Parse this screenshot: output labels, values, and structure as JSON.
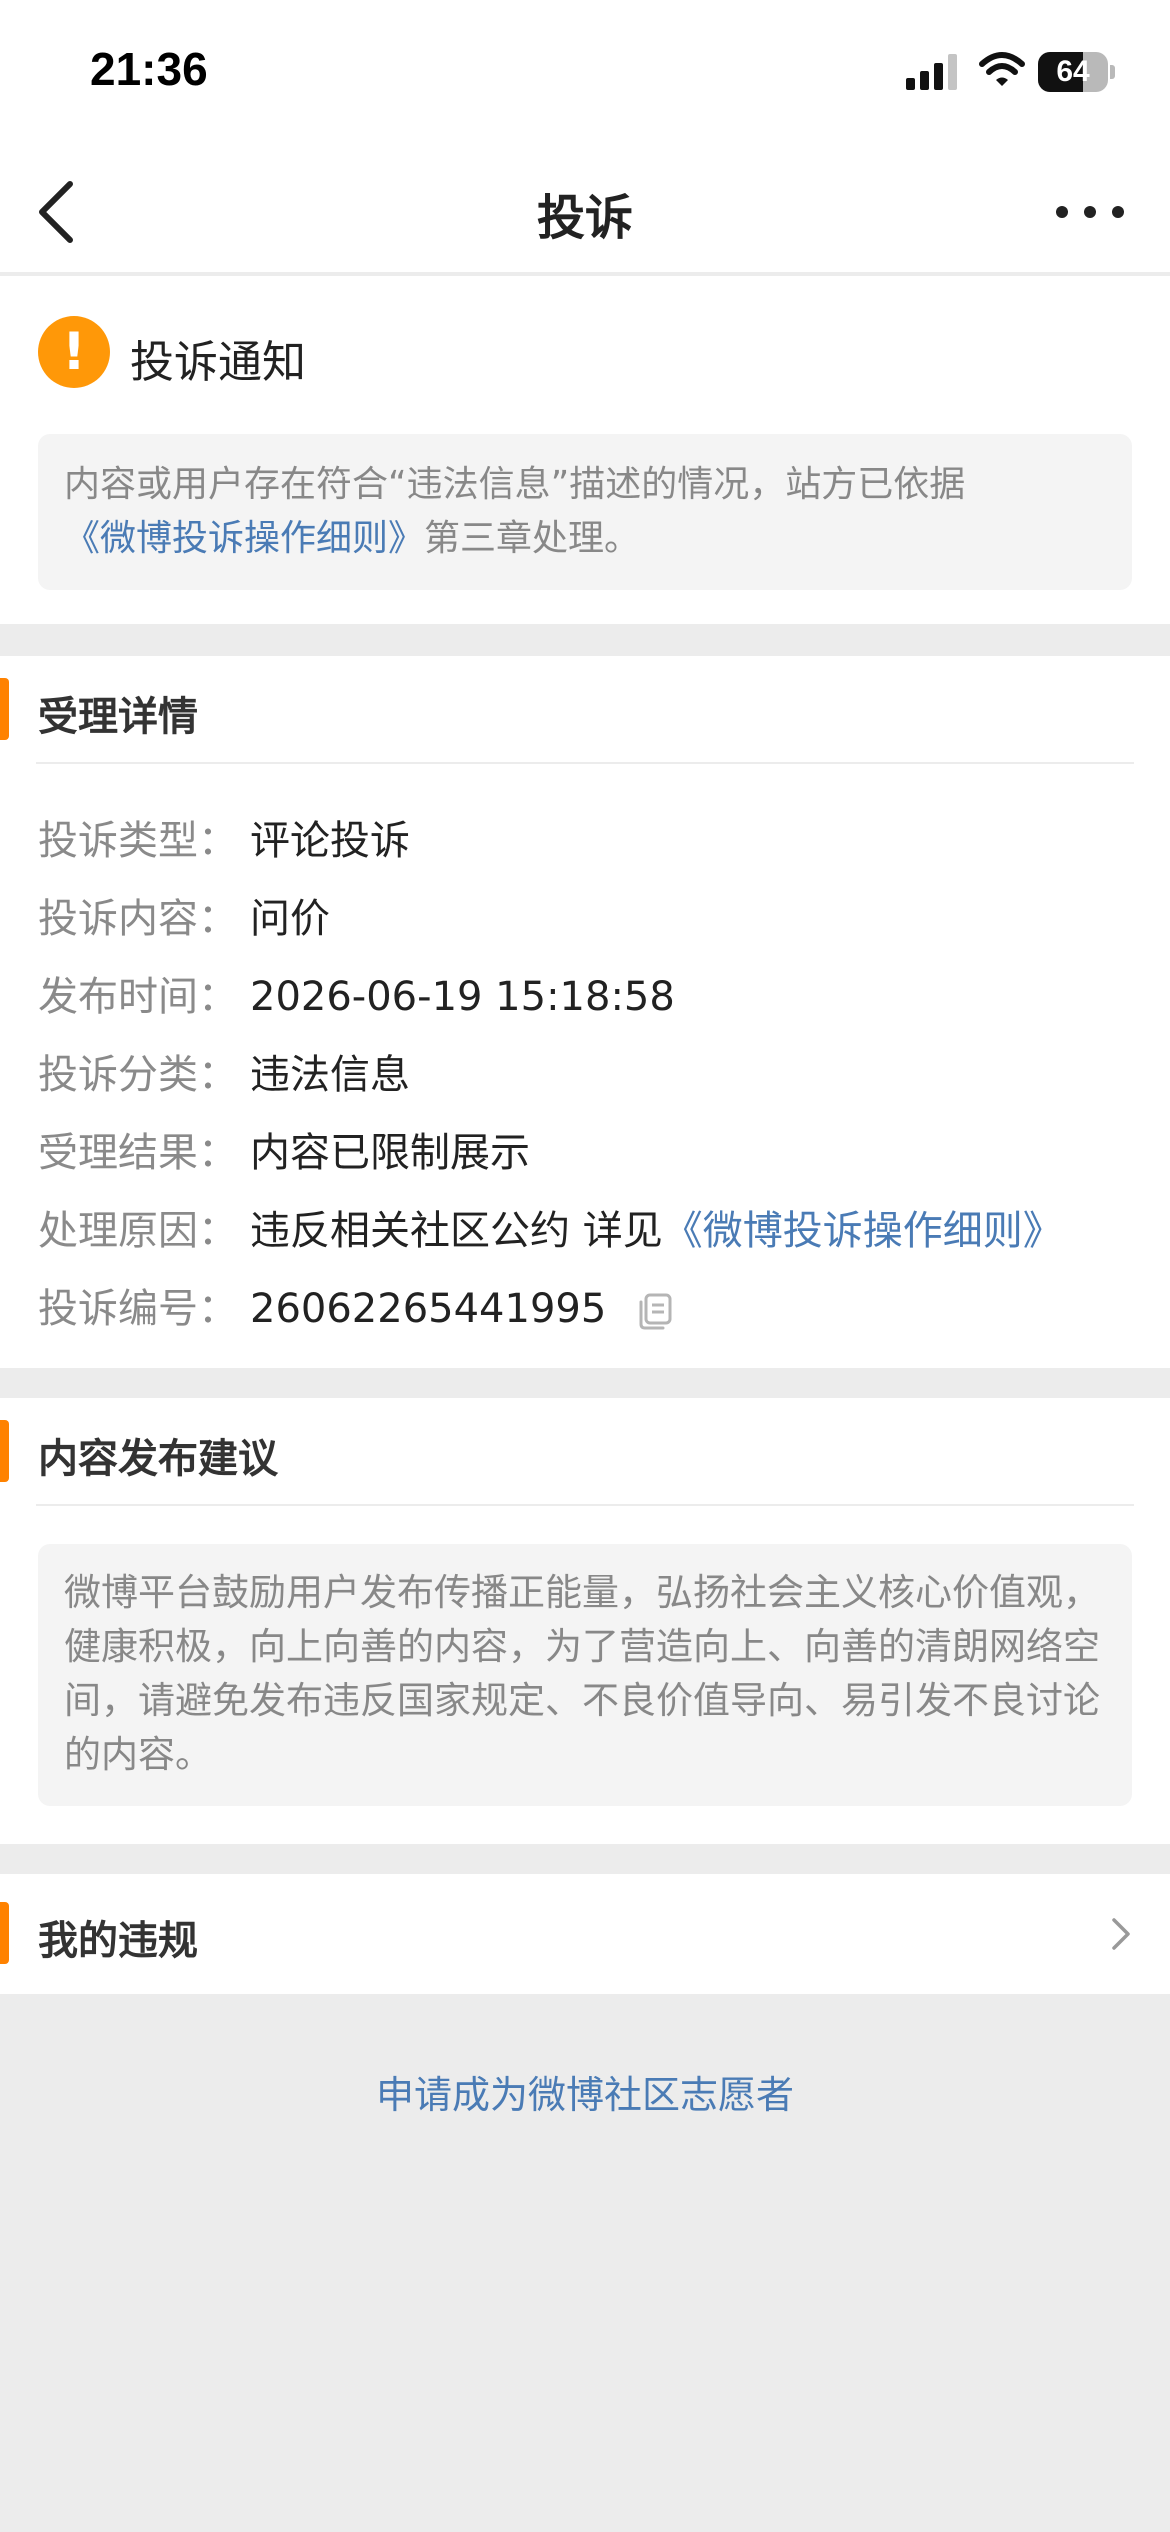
{
  "status_bar": {
    "time": "21:36",
    "battery_text": "64",
    "battery_level": 0.64,
    "icons": [
      "signal-icon",
      "wifi-icon",
      "battery-icon"
    ]
  },
  "nav": {
    "title": "投诉",
    "back_icon": "chevron-left-icon",
    "more_icon": "more-icon"
  },
  "notice": {
    "icon": "exclamation-icon",
    "icon_color": "#ff9808",
    "title": "投诉通知",
    "text": "内容或用户存在符合“违法信息”描述的情况，站方已依据",
    "link": "《微博投诉操作细则》",
    "text_after": "第三章处理。"
  },
  "details": {
    "title": "受理详情",
    "rows": [
      {
        "label": "投诉类型：",
        "value": "评论投诉"
      },
      {
        "label": "投诉内容：",
        "value": "问价"
      },
      {
        "label": "发布时间：",
        "value": "2026-06-19 15:18:58"
      },
      {
        "label": "投诉分类：",
        "value": "违法信息"
      },
      {
        "label": "受理结果：",
        "value": "内容已限制展示"
      },
      {
        "label": "处理原因：",
        "value": "违反相关社区公约 详见",
        "link": "《微博投诉操作细则》"
      },
      {
        "label": "投诉编号：",
        "value": "26062265441995",
        "icon": "copy-icon"
      }
    ]
  },
  "suggestion": {
    "title": "内容发布建议",
    "text": "微博平台鼓励用户发布传播正能量，弘扬社会主义核心价值观，健康积极，向上向善的内容，为了营造向上、向善的清朗网络空间，请避免发布违反国家规定、不良价值导向、易引发不良讨论的内容。"
  },
  "violations": {
    "title": "我的违规",
    "icon": "chevron-right-icon"
  },
  "volunteer_link": "申请成为微博社区志愿者",
  "colors": {
    "accent": "#ff8200",
    "link": "#4a7bb5",
    "page_bg": "#ececec"
  }
}
